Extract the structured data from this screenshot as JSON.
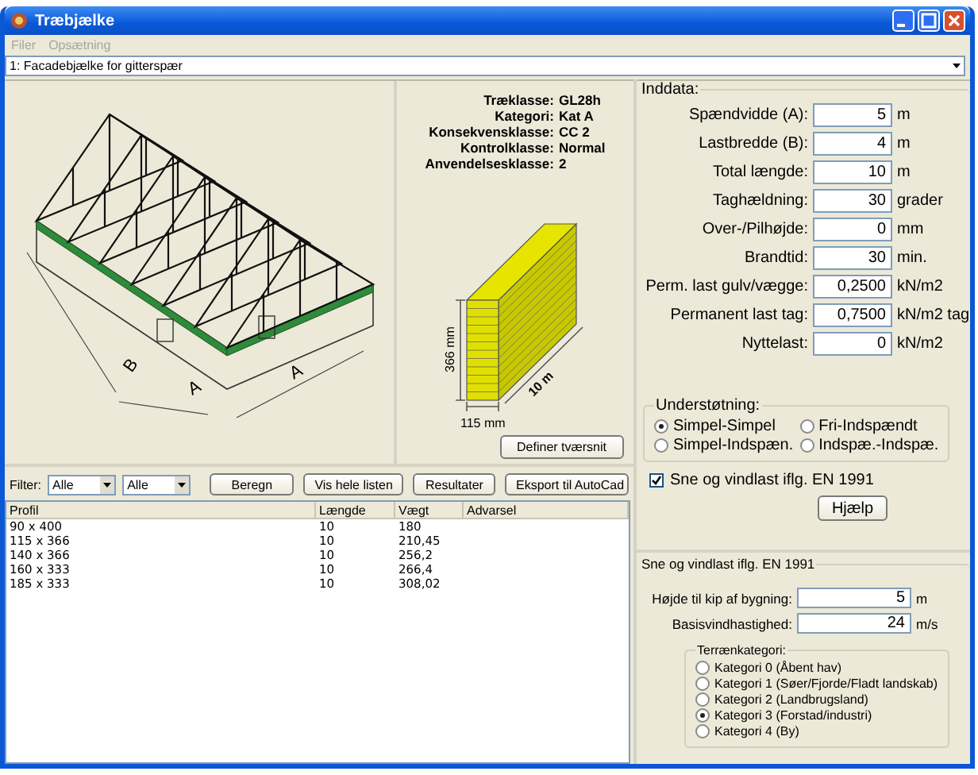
{
  "window": {
    "title": "Træbjælke"
  },
  "menu": [
    {
      "label": "Filer",
      "disabled": true
    },
    {
      "label": "Opsætning",
      "disabled": true
    }
  ],
  "selector": {
    "value": "1: Facadebjælke for gitterspær"
  },
  "frame_drawing": {
    "labels": [
      "B",
      "A",
      "A"
    ]
  },
  "properties": [
    {
      "label": "Træklasse:",
      "value": "GL28h"
    },
    {
      "label": "Kategori:",
      "value": "Kat A"
    },
    {
      "label": "Konsekvensklasse:",
      "value": "CC 2"
    },
    {
      "label": "Kontrolklasse:",
      "value": "Normal"
    },
    {
      "label": "Anvendelsesklasse:",
      "value": "2"
    }
  ],
  "cross_section": {
    "height_label": "366 mm",
    "width_label": "115 mm",
    "length_label": "10 m"
  },
  "define_button": "Definer tværsnit",
  "filter": {
    "label": "Filter:",
    "dropdowns": [
      "Alle",
      "Alle"
    ]
  },
  "actions": [
    "Beregn",
    "Vis hele listen",
    "Resultater",
    "Eksport til AutoCad"
  ],
  "table": {
    "columns": [
      "Profil",
      "Længde",
      "Vægt",
      "Advarsel"
    ],
    "rows": [
      [
        "90 x 400",
        "10",
        "180"
      ],
      [
        "115 x 366",
        "10",
        "210,45"
      ],
      [
        "140 x 366",
        "10",
        "256,2"
      ],
      [
        "160 x 333",
        "10",
        "266,4"
      ],
      [
        "185 x 333",
        "10",
        "308,02"
      ]
    ]
  },
  "inddata": {
    "title": "Inddata:",
    "fields": [
      {
        "label": "Spændvidde (A):",
        "value": "5",
        "unit": "m"
      },
      {
        "label": "Lastbredde (B):",
        "value": "4",
        "unit": "m"
      },
      {
        "label": "Total længde:",
        "value": "10",
        "unit": "m"
      },
      {
        "label": "Taghældning:",
        "value": "30",
        "unit": "grader"
      },
      {
        "label": "Over-/Pilhøjde:",
        "value": "0",
        "unit": "mm"
      },
      {
        "label": "Brandtid:",
        "value": "30",
        "unit": "min."
      },
      {
        "label": "Perm. last gulv/vægge:",
        "value": "0,2500",
        "unit": "kN/m2"
      },
      {
        "label": "Permanent last tag:",
        "value": "0,7500",
        "unit": "kN/m2 tag"
      },
      {
        "label": "Nyttelast:",
        "value": "0",
        "unit": "kN/m2"
      }
    ]
  },
  "support": {
    "title": "Understøtning:",
    "options": [
      {
        "label": "Simpel-Simpel",
        "selected": true
      },
      {
        "label": "Fri-Indspændt",
        "selected": false
      },
      {
        "label": "Simpel-Indspæn.",
        "selected": false
      },
      {
        "label": "Indspæ.-Indspæ.",
        "selected": false
      }
    ]
  },
  "snow_checkbox": {
    "label": "Sne og vindlast iflg. EN 1991",
    "checked": true
  },
  "help_button": "Hjælp",
  "snow_wind": {
    "title": "Sne og vindlast iflg. EN 1991",
    "fields": [
      {
        "label": "Højde til kip af bygning:",
        "value": "5",
        "unit": "m"
      },
      {
        "label": "Basisvindhastighed:",
        "value": "24",
        "unit": "m/s"
      }
    ],
    "terrain": {
      "title": "Terrænkategori:",
      "options": [
        {
          "label": "Kategori 0 (Åbent hav)",
          "selected": false
        },
        {
          "label": "Kategori 1 (Søer/Fjorde/Fladt landskab)",
          "selected": false
        },
        {
          "label": "Kategori 2 (Landbrugsland)",
          "selected": false
        },
        {
          "label": "Kategori 3 (Forstad/industri)",
          "selected": true
        },
        {
          "label": "Kategori 4 (By)",
          "selected": false
        }
      ]
    }
  }
}
